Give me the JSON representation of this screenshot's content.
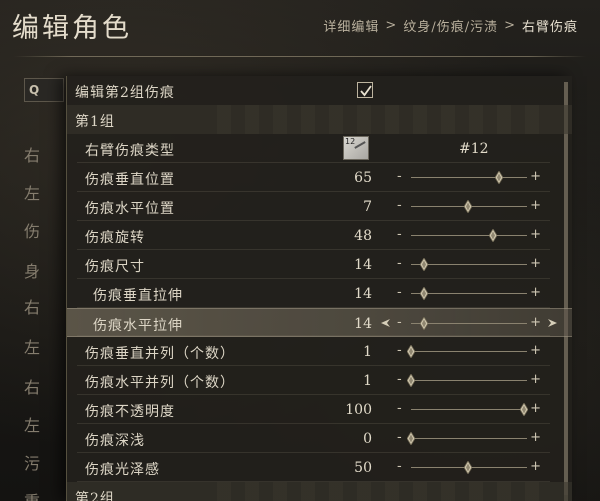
{
  "page": {
    "title": "编辑角色",
    "breadcrumb": [
      "详细编辑",
      ">",
      "纹身/伤痕/污渍",
      ">",
      "右臂伤痕"
    ]
  },
  "left_column": {
    "search_label": "Q",
    "categories": [
      "右",
      "左",
      "伤",
      "身",
      "右",
      "左",
      "右",
      "左",
      "污",
      "重"
    ]
  },
  "panel": {
    "edit_group2": {
      "label": "编辑第2组伤痕",
      "checked": true
    },
    "group1_title": "第1组",
    "scar_type": {
      "label": "右臂伤痕类型",
      "thumb_number": "12",
      "value": "#12"
    },
    "sliders": [
      {
        "label": "伤痕垂直位置",
        "value": "65",
        "level": 0.76,
        "indent": false
      },
      {
        "label": "伤痕水平位置",
        "value": "7",
        "level": 0.49,
        "indent": false
      },
      {
        "label": "伤痕旋转",
        "value": "48",
        "level": 0.71,
        "indent": false
      },
      {
        "label": "伤痕尺寸",
        "value": "14",
        "level": 0.11,
        "indent": false
      },
      {
        "label": "伤痕垂直拉伸",
        "value": "14",
        "level": 0.11,
        "indent": true
      },
      {
        "label": "伤痕水平拉伸",
        "value": "14",
        "level": 0.11,
        "indent": true,
        "selected": true
      },
      {
        "label": "伤痕垂直并列（个数）",
        "value": "1",
        "level": 0.0,
        "indent": false
      },
      {
        "label": "伤痕水平并列（个数）",
        "value": "1",
        "level": 0.0,
        "indent": false
      },
      {
        "label": "伤痕不透明度",
        "value": "100",
        "level": 0.97,
        "indent": false
      },
      {
        "label": "伤痕深浅",
        "value": "0",
        "level": 0.0,
        "indent": false
      },
      {
        "label": "伤痕光泽感",
        "value": "50",
        "level": 0.49,
        "indent": false
      }
    ],
    "group2_title": "第2组",
    "minus_symbol": "-",
    "plus_symbol": "+"
  }
}
